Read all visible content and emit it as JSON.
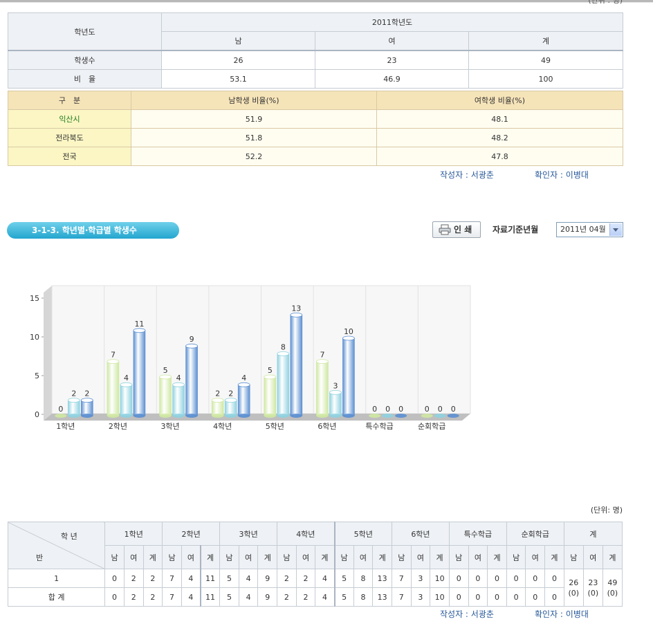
{
  "top_unit": "(단위 : 명)",
  "table1": {
    "row_header": "학년도",
    "year": "2011학년도",
    "cols": [
      "남",
      "여",
      "계"
    ],
    "rows": [
      {
        "label": "학생수",
        "values": [
          "26",
          "23",
          "49"
        ]
      },
      {
        "label": "비　율",
        "values": [
          "53.1",
          "46.9",
          "100"
        ]
      }
    ]
  },
  "table2": {
    "headers": [
      "구　분",
      "남학생 비율(%)",
      "여학생 비율(%)"
    ],
    "rows": [
      {
        "label": "익산시",
        "male": "51.9",
        "female": "48.1"
      },
      {
        "label": "전라북도",
        "male": "51.8",
        "female": "48.2"
      },
      {
        "label": "전국",
        "male": "52.2",
        "female": "47.8"
      }
    ]
  },
  "sign1": {
    "writer": "작성자 : 서광춘",
    "checker": "확인자 : 이병대"
  },
  "section_title": "3-1-3. 학년별·학급별 학생수",
  "print_label": "인 쇄",
  "date_label": "자료기준년월",
  "date_value": "2011년 04월",
  "chart_data": {
    "type": "bar",
    "categories": [
      "1학년",
      "2학년",
      "3학년",
      "4학년",
      "5학년",
      "6학년",
      "특수학급",
      "순회학급"
    ],
    "series": [
      {
        "values": [
          0,
          7,
          5,
          2,
          5,
          7,
          0,
          0
        ],
        "color": "#cfe8a2"
      },
      {
        "values": [
          2,
          4,
          4,
          2,
          8,
          3,
          0,
          0
        ],
        "color": "#8fd2e0"
      },
      {
        "values": [
          2,
          11,
          9,
          4,
          13,
          10,
          0,
          0
        ],
        "color": "#5b8fd1"
      }
    ],
    "y_ticks": [
      "0",
      "5",
      "10",
      "15"
    ],
    "ylim": [
      0,
      15
    ],
    "grid": true
  },
  "unit_label": "(단위: 명)",
  "table3": {
    "corner_top": "학 년",
    "corner_bottom": "반",
    "groups": [
      "1학년",
      "2학년",
      "3학년",
      "4학년",
      "5학년",
      "6학년",
      "특수학급",
      "순회학급"
    ],
    "total_label": "계",
    "sub_cols": [
      "남",
      "여",
      "계"
    ],
    "rows": [
      {
        "label": "1",
        "values": [
          "0",
          "2",
          "2",
          "7",
          "4",
          "11",
          "5",
          "4",
          "9",
          "2",
          "2",
          "4",
          "5",
          "8",
          "13",
          "7",
          "3",
          "10",
          "0",
          "0",
          "0",
          "0",
          "0",
          "0"
        ]
      },
      {
        "label": "합 계",
        "values": [
          "0",
          "2",
          "2",
          "7",
          "4",
          "11",
          "5",
          "4",
          "9",
          "2",
          "2",
          "4",
          "5",
          "8",
          "13",
          "7",
          "3",
          "10",
          "0",
          "0",
          "0",
          "0",
          "0",
          "0"
        ]
      }
    ],
    "totals": [
      {
        "value": "26",
        "paren": "(0)"
      },
      {
        "value": "23",
        "paren": "(0)"
      },
      {
        "value": "49",
        "paren": "(0)"
      }
    ]
  },
  "sign2": {
    "writer": "작성자 : 서광춘",
    "checker": "확인자 : 이병대"
  }
}
